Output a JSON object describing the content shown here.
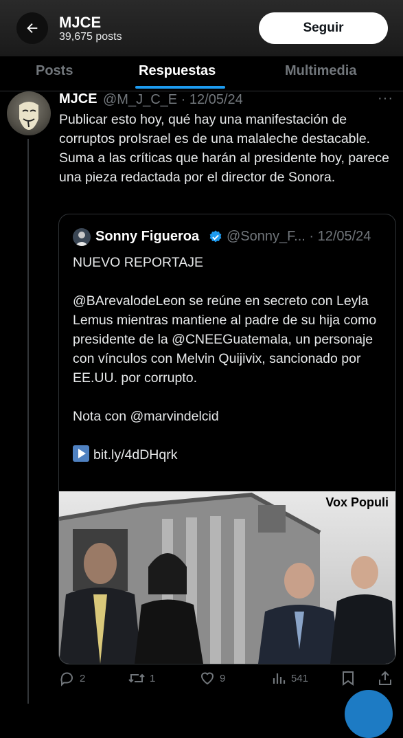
{
  "header": {
    "name": "MJCE",
    "posts": "39,675 posts",
    "follow_label": "Seguir"
  },
  "tabs": [
    "Posts",
    "Respuestas",
    "Multimedia"
  ],
  "tweet": {
    "name": "MJCE",
    "handle_date": "@M_J_C_E · 12/05/24",
    "more": "···",
    "text": "Publicar esto hoy, qué hay una manifestación de corruptos proIsrael es de una malaleche destacable. Suma a las críticas que harán al presidente hoy, parece una pieza redactada por el director de Sonora."
  },
  "quote": {
    "name": "Sonny Figueroa",
    "handle_date": "@Sonny_F... · 12/05/24",
    "lines": {
      "l1": "NUEVO REPORTAJE",
      "l2": "@BArevalodeLeon se reúne en secreto con Leyla Lemus mientras mantiene al padre de su hija como presidente de la @CNEEGuatemala, un personaje con vínculos con Melvin Quijivix, sancionado por EE.UU. por corrupto.",
      "l3": "Nota con @marvindelcid",
      "l4": "bit.ly/4dDHqrk"
    },
    "image_label": "Vox Populi"
  },
  "actions": {
    "replies": "2",
    "reposts": "1",
    "likes": "9",
    "views": "541"
  },
  "colors": {
    "accent": "#1d9bf0",
    "muted": "#71767b",
    "background": "#000000"
  },
  "icons": [
    "back-arrow-icon",
    "verified-badge-icon",
    "play-button-icon",
    "reply-icon",
    "repost-icon",
    "like-icon",
    "views-icon",
    "bookmark-icon",
    "share-icon"
  ]
}
